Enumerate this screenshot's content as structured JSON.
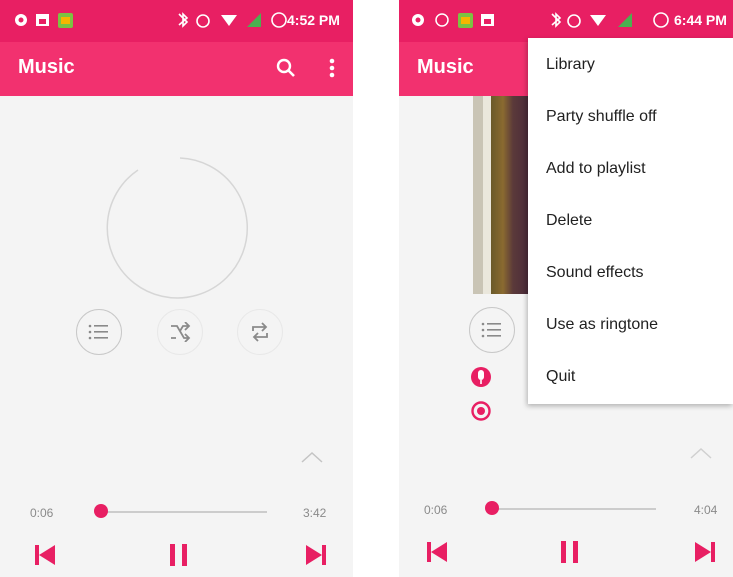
{
  "left": {
    "status": {
      "time": "4:52 PM"
    },
    "app_title": "Music",
    "progress": {
      "current": "0:06",
      "total": "3:42",
      "fraction": 0.03
    }
  },
  "right": {
    "status": {
      "time": "6:44 PM"
    },
    "app_title": "Music",
    "menu": [
      "Library",
      "Party shuffle off",
      "Add to playlist",
      "Delete",
      "Sound effects",
      "Use as ringtone",
      "Quit"
    ],
    "progress": {
      "current": "0:06",
      "total": "4:04",
      "fraction": 0.03
    }
  },
  "colors": {
    "accent": "#e81f63",
    "appbar": "#f2316f",
    "statusbar": "#e81f63"
  },
  "icons": [
    "search-icon",
    "overflow-menu-icon",
    "queue-list-icon",
    "shuffle-icon",
    "repeat-icon",
    "previous-icon",
    "pause-icon",
    "next-icon",
    "expand-up-icon",
    "microphone-icon",
    "record-icon"
  ]
}
